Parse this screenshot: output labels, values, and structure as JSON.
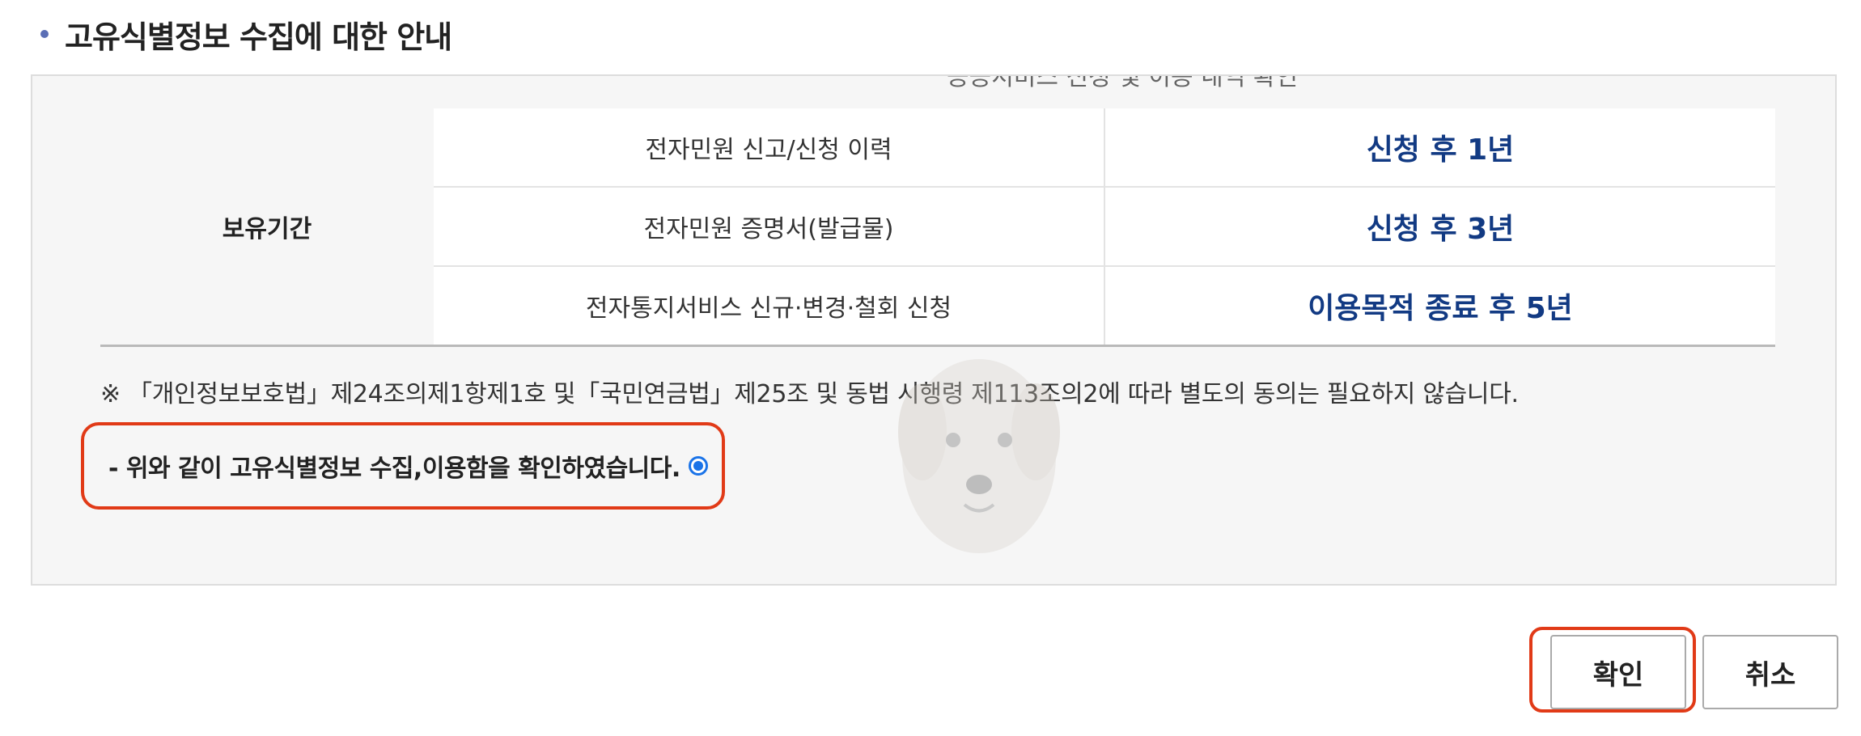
{
  "section": {
    "title": "고유식별정보 수집에 대한 안내"
  },
  "table": {
    "cut_text": "공공서비스 신청 및 이용 내역 확인",
    "label": "보유기간",
    "rows": [
      {
        "item": "전자민원 신고/신청 이력",
        "period": "신청 후 1년"
      },
      {
        "item": "전자민원 증명서(발급물)",
        "period": "신청 후 3년"
      },
      {
        "item": "전자통지서비스 신규·변경·철회 신청",
        "period": "이용목적 종료 후 5년"
      }
    ]
  },
  "note": "※ 「개인정보보호법」제24조의제1항제1호 및「국민연금법」제25조 및 동법 시행령 제113조의2에 따라 별도의 동의는 필요하지 않습니다.",
  "confirm": {
    "text": "- 위와 같이 고유식별정보 수집,이용함을 확인하였습니다.",
    "selected": true
  },
  "buttons": {
    "confirm_label": "확인",
    "cancel_label": "취소"
  },
  "colors": {
    "accent_navy": "#123a83",
    "highlight_red": "#e13a17",
    "radio_blue": "#1a73e8",
    "bullet": "#5a6eb5"
  },
  "icons": {
    "watermark": "puppy-watermark-icon"
  }
}
